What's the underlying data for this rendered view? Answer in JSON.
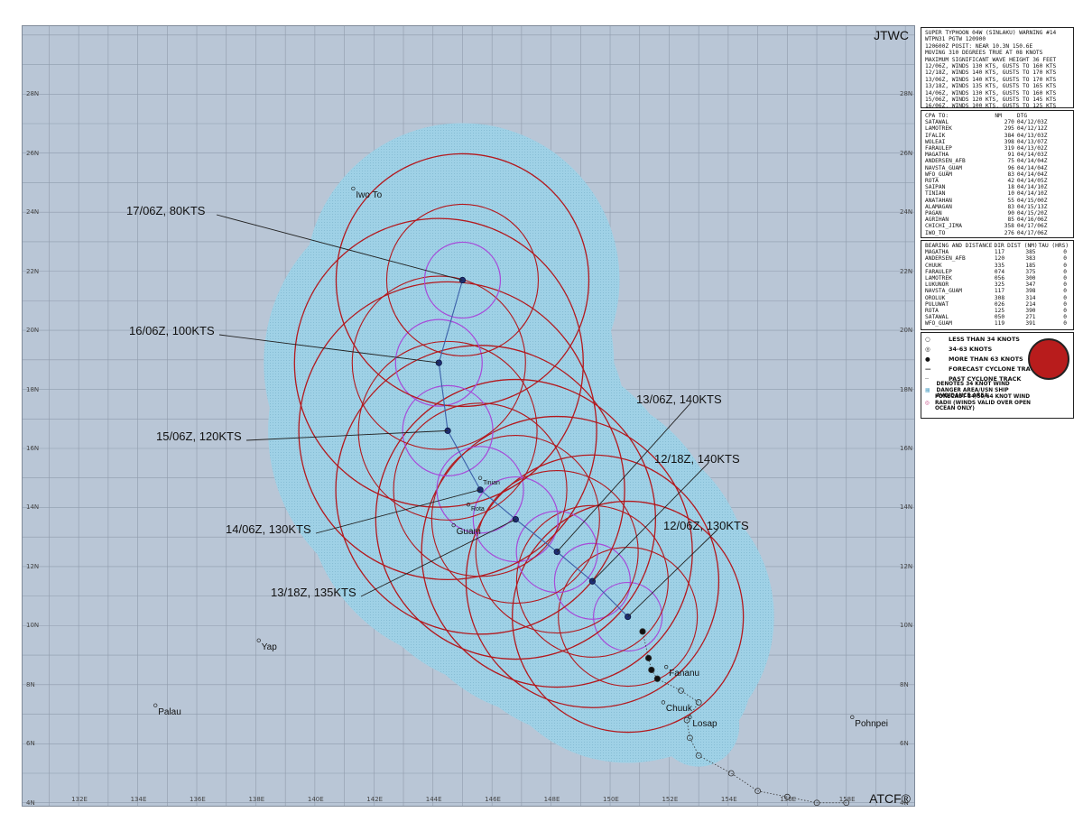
{
  "header": {
    "lines": [
      "SUPER TYPHOON 04W (SINLAKU) WARNING #14",
      "WTPN31 PGTW 120900",
      "120600Z POSIT: NEAR 10.3N 150.6E",
      "MOVING 310 DEGREES TRUE AT 08 KNOTS",
      "MAXIMUM SIGNIFICANT WAVE HEIGHT 36 FEET",
      "12/06Z, WINDS 130 KTS, GUSTS TO 160 KTS",
      "12/18Z, WINDS 140 KTS, GUSTS TO 170 KTS",
      "13/06Z, WINDS 140 KTS, GUSTS TO 170 KTS",
      "13/18Z, WINDS 135 KTS, GUSTS TO 165 KTS",
      "14/06Z, WINDS 130 KTS, GUSTS TO 160 KTS",
      "15/06Z, WINDS 120 KTS, GUSTS TO 145 KTS",
      "16/06Z, WINDS 100 KTS, GUSTS TO 125 KTS",
      "17/06Z, WINDS 080 KTS, GUSTS TO 100 KTS"
    ]
  },
  "cpa": {
    "title": "CPA TO:",
    "col_nm": "NM",
    "col_dtg": "DTG",
    "rows": [
      [
        "SATAWAL",
        "270",
        "04/12/03Z"
      ],
      [
        "LAMOTREK",
        "295",
        "04/12/12Z"
      ],
      [
        "IFALIK",
        "384",
        "04/13/03Z"
      ],
      [
        "WOLEAI",
        "398",
        "04/13/07Z"
      ],
      [
        "FARAULEP",
        "319",
        "04/13/02Z"
      ],
      [
        "MAGATHA",
        "91",
        "04/14/03Z"
      ],
      [
        "ANDERSEN_AFB",
        "75",
        "04/14/04Z"
      ],
      [
        "NAVSTA_GUAM",
        "96",
        "04/14/04Z"
      ],
      [
        "WFO_GUAM",
        "83",
        "04/14/04Z"
      ],
      [
        "ROTA",
        "42",
        "04/14/05Z"
      ],
      [
        "SAIPAN",
        "18",
        "04/14/10Z"
      ],
      [
        "TINIAN",
        "10",
        "04/14/10Z"
      ],
      [
        "ANATAHAN",
        "55",
        "04/15/00Z"
      ],
      [
        "ALAMAGAN",
        "83",
        "04/15/13Z"
      ],
      [
        "PAGAN",
        "90",
        "04/15/20Z"
      ],
      [
        "AGRIHAN",
        "85",
        "04/16/06Z"
      ],
      [
        "CHICHI_JIMA",
        "358",
        "04/17/06Z"
      ],
      [
        "IWO_TO",
        "276",
        "04/17/06Z"
      ]
    ]
  },
  "bearing": {
    "title": "BEARING AND DISTANCE",
    "col_dir": "DIR",
    "col_dist": "DIST (NM)",
    "col_tau": "TAU (HRS)",
    "rows": [
      [
        "MAGATHA",
        "117",
        "385",
        "0"
      ],
      [
        "ANDERSEN_AFB",
        "120",
        "383",
        "0"
      ],
      [
        "CHUUK",
        "335",
        "185",
        "0"
      ],
      [
        "FARAULEP",
        "074",
        "375",
        "0"
      ],
      [
        "LAMOTREK",
        "056",
        "300",
        "0"
      ],
      [
        "LUKUNOR",
        "325",
        "347",
        "0"
      ],
      [
        "NAVSTA_GUAM",
        "117",
        "398",
        "0"
      ],
      [
        "OROLUK",
        "308",
        "314",
        "0"
      ],
      [
        "PULUWAT",
        "026",
        "214",
        "0"
      ],
      [
        "ROTA",
        "125",
        "390",
        "0"
      ],
      [
        "SATAWAL",
        "050",
        "271",
        "0"
      ],
      [
        "WFO_GUAM",
        "119",
        "391",
        "0"
      ]
    ]
  },
  "legend": {
    "items": [
      "LESS THAN 34 KNOTS",
      "34-63 KNOTS",
      "MORE THAN 63 KNOTS",
      "FORECAST CYCLONE TRACK",
      "PAST CYCLONE TRACK",
      "DENOTES 34 KNOT WIND DANGER AREA/USN SHIP AVOIDANCE AREA",
      "FORECAST 34/50/64 KNOT WIND RADII (WINDS VALID OVER OPEN OCEAN ONLY)"
    ]
  },
  "map": {
    "corner_top": "JTWC",
    "corner_bottom": "ATCF®",
    "lat_ticks": [
      "28N",
      "26N",
      "24N",
      "22N",
      "20N",
      "18N",
      "16N",
      "14N",
      "12N",
      "10N",
      "8N",
      "6N",
      "4N"
    ],
    "lon_ticks": [
      "132E",
      "134E",
      "136E",
      "138E",
      "140E",
      "142E",
      "144E",
      "146E",
      "148E",
      "150E",
      "152E",
      "154E",
      "156E",
      "158E"
    ],
    "lat_range": [
      3.9,
      30.3
    ],
    "lon_range": [
      130.1,
      160.3
    ],
    "places": [
      {
        "name": "Iwo To",
        "lat": 24.8,
        "lon": 141.3
      },
      {
        "name": "Guam",
        "lat": 13.4,
        "lon": 144.7
      },
      {
        "name": "Rota",
        "lat": 14.1,
        "lon": 145.2
      },
      {
        "name": "Tinian",
        "lat": 15.0,
        "lon": 145.6
      },
      {
        "name": "Yap",
        "lat": 9.5,
        "lon": 138.1
      },
      {
        "name": "Palau",
        "lat": 7.3,
        "lon": 134.6
      },
      {
        "name": "Chuuk",
        "lat": 7.4,
        "lon": 151.8
      },
      {
        "name": "Fananu",
        "lat": 8.6,
        "lon": 151.9
      },
      {
        "name": "Losap",
        "lat": 6.9,
        "lon": 152.7
      },
      {
        "name": "Pohnpei",
        "lat": 6.9,
        "lon": 158.2
      }
    ],
    "forecast_points": [
      {
        "label": "12/06Z, 130KTS",
        "lat": 10.3,
        "lon": 150.6
      },
      {
        "label": "12/18Z, 140KTS",
        "lat": 11.5,
        "lon": 149.4
      },
      {
        "label": "13/06Z, 140KTS",
        "lat": 12.5,
        "lon": 148.2
      },
      {
        "label": "13/18Z, 135KTS",
        "lat": 13.6,
        "lon": 146.8
      },
      {
        "label": "14/06Z, 130KTS",
        "lat": 14.6,
        "lon": 145.6
      },
      {
        "label": "15/06Z, 120KTS",
        "lat": 16.6,
        "lon": 144.5
      },
      {
        "label": "16/06Z, 100KTS",
        "lat": 18.9,
        "lon": 144.2
      },
      {
        "label": "17/06Z, 80KTS",
        "lat": 21.7,
        "lon": 145.0
      }
    ],
    "past_track": [
      {
        "lat": 4.0,
        "lon": 158.0
      },
      {
        "lat": 4.0,
        "lon": 157.0
      },
      {
        "lat": 4.2,
        "lon": 156.0
      },
      {
        "lat": 4.4,
        "lon": 155.0
      },
      {
        "lat": 5.0,
        "lon": 154.1
      },
      {
        "lat": 5.6,
        "lon": 153.0
      },
      {
        "lat": 6.2,
        "lon": 152.7
      },
      {
        "lat": 6.8,
        "lon": 152.6
      },
      {
        "lat": 7.4,
        "lon": 153.0
      },
      {
        "lat": 7.8,
        "lon": 152.4
      },
      {
        "lat": 8.2,
        "lon": 151.6
      },
      {
        "lat": 8.5,
        "lon": 151.4
      },
      {
        "lat": 8.9,
        "lon": 151.3
      },
      {
        "lat": 9.8,
        "lon": 151.1
      }
    ],
    "colors": {
      "danger_area": "#9fd1e6",
      "radii": "#b3181d",
      "radii64": "#a64ad9",
      "track": "#3b5fa8",
      "ocean": "#b9c6d6"
    }
  }
}
